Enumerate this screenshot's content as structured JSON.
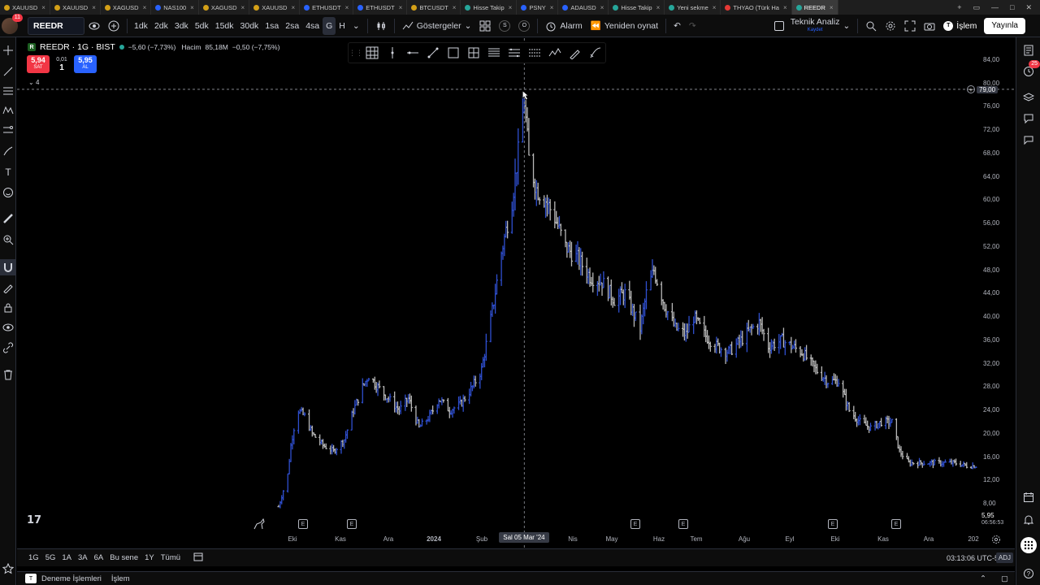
{
  "browser": {
    "tabs": [
      {
        "label": "XAUUSD",
        "fav": "y"
      },
      {
        "label": "XAUUSD",
        "fav": "y"
      },
      {
        "label": "XAGUSD",
        "fav": "y"
      },
      {
        "label": "NAS100",
        "fav": "b"
      },
      {
        "label": "XAGUSD",
        "fav": "y"
      },
      {
        "label": "XAUUSD",
        "fav": "y"
      },
      {
        "label": "ETHUSDT",
        "fav": "b"
      },
      {
        "label": "ETHUSDT",
        "fav": "b"
      },
      {
        "label": "BTCUSDT",
        "fav": "y"
      },
      {
        "label": "Hisse Takip",
        "fav": "g"
      },
      {
        "label": "PSNY",
        "fav": "b"
      },
      {
        "label": "ADAUSD",
        "fav": "b"
      },
      {
        "label": "Hisse Takip",
        "fav": "g"
      },
      {
        "label": "Yeni sekme",
        "fav": "g"
      },
      {
        "label": "THYAO (Türk Ha",
        "fav": "r"
      },
      {
        "label": "REEDR",
        "fav": "g",
        "active": true
      }
    ]
  },
  "toolbar": {
    "notifications": "11",
    "symbol": "REEDR",
    "intervals": [
      "1dk",
      "2dk",
      "3dk",
      "5dk",
      "15dk",
      "30dk",
      "1sa",
      "2sa",
      "4sa",
      "G",
      "H"
    ],
    "selected_interval": "G",
    "indicators_label": "Göstergeler",
    "alarm_label": "Alarm",
    "replay_label": "Yeniden oynat",
    "layout_name": "Teknik Analiz",
    "layout_status": "Kaydet",
    "trade_label": "İşlem",
    "publish_label": "Yayınla"
  },
  "legend": {
    "title": "REEDR · 1G · BIST",
    "change": "−5,60 (−7,73%)",
    "volume_label": "Hacim",
    "volume": "85,18M",
    "volume_change": "−0,50 (−7,75%)",
    "sell_price": "5,94",
    "sell_label": "SAT",
    "buy_price": "5,95",
    "buy_label": "AL",
    "spread": "0,01",
    "quantity": "1",
    "collapsed_count": "4"
  },
  "price_axis": {
    "ticks": [
      "84,00",
      "80,00",
      "76,00",
      "72,00",
      "68,00",
      "64,00",
      "60,00",
      "56,00",
      "52,00",
      "48,00",
      "44,00",
      "40,00",
      "36,00",
      "32,00",
      "28,00",
      "24,00",
      "20,00",
      "16,00",
      "12,00",
      "8,00"
    ],
    "crosshair_price": "79,00",
    "last_price": "5,95",
    "countdown": "06:56:53"
  },
  "time_axis": {
    "ticks": [
      "Eki",
      "Kas",
      "Ara",
      "2024",
      "Şub",
      "Nis",
      "May",
      "Haz",
      "Tem",
      "Ağu",
      "Eyl",
      "Eki",
      "Kas",
      "Ara",
      "202"
    ],
    "crosshair_time": "Sal 05 Mar '24",
    "event_badge": "E"
  },
  "bottom": {
    "ranges": [
      "1G",
      "5G",
      "1A",
      "3A",
      "6A",
      "Bu sene",
      "1Y",
      "Tümü"
    ],
    "clock": "03:13:06 UTC-5",
    "adj": "ADJ",
    "panel_left": "Deneme İşlemleri",
    "panel_right": "İşlem",
    "right_badge": "25"
  },
  "colors": {
    "up": "#2f4fcf",
    "down": "#b8b8b8",
    "crosshair": "#9598a1",
    "background": "#000000",
    "accent": "#2962ff",
    "sell": "#f23645"
  },
  "chart_data": {
    "type": "bar",
    "style": "ohlc-bars",
    "title": "REEDR · 1G · BIST",
    "ylim": [
      8,
      84
    ],
    "series": [
      {
        "values": [
          {
            "date": "2023-09-26",
            "price": 7.5
          },
          {
            "date": "2023-10-02",
            "price": 13
          },
          {
            "date": "2023-10-04",
            "price": 18
          },
          {
            "date": "2023-10-06",
            "price": 21
          },
          {
            "date": "2023-10-09",
            "price": 24
          },
          {
            "date": "2023-10-13",
            "price": 23
          },
          {
            "date": "2023-10-18",
            "price": 20
          },
          {
            "date": "2023-10-25",
            "price": 18
          },
          {
            "date": "2023-11-01",
            "price": 17
          },
          {
            "date": "2023-11-08",
            "price": 19
          },
          {
            "date": "2023-11-14",
            "price": 24
          },
          {
            "date": "2023-11-20",
            "price": 28
          },
          {
            "date": "2023-11-24",
            "price": 30
          },
          {
            "date": "2023-11-30",
            "price": 28
          },
          {
            "date": "2023-12-07",
            "price": 26
          },
          {
            "date": "2023-12-14",
            "price": 24
          },
          {
            "date": "2023-12-20",
            "price": 26
          },
          {
            "date": "2023-12-27",
            "price": 21
          },
          {
            "date": "2024-01-03",
            "price": 23
          },
          {
            "date": "2024-01-09",
            "price": 26
          },
          {
            "date": "2024-01-16",
            "price": 24
          },
          {
            "date": "2024-01-23",
            "price": 25
          },
          {
            "date": "2024-01-31",
            "price": 28
          },
          {
            "date": "2024-02-06",
            "price": 31
          },
          {
            "date": "2024-02-13",
            "price": 41
          },
          {
            "date": "2024-02-19",
            "price": 51
          },
          {
            "date": "2024-02-26",
            "price": 60
          },
          {
            "date": "2024-03-01",
            "price": 68
          },
          {
            "date": "2024-03-05",
            "price": 77
          },
          {
            "date": "2024-03-08",
            "price": 67
          },
          {
            "date": "2024-03-13",
            "price": 62
          },
          {
            "date": "2024-03-19",
            "price": 60
          },
          {
            "date": "2024-03-25",
            "price": 57
          },
          {
            "date": "2024-04-01",
            "price": 52
          },
          {
            "date": "2024-04-09",
            "price": 50
          },
          {
            "date": "2024-04-17",
            "price": 47
          },
          {
            "date": "2024-04-25",
            "price": 46
          },
          {
            "date": "2024-05-03",
            "price": 43
          },
          {
            "date": "2024-05-10",
            "price": 44
          },
          {
            "date": "2024-05-20",
            "price": 38
          },
          {
            "date": "2024-05-24",
            "price": 44
          },
          {
            "date": "2024-05-29",
            "price": 48
          },
          {
            "date": "2024-06-05",
            "price": 42
          },
          {
            "date": "2024-06-12",
            "price": 38
          },
          {
            "date": "2024-06-19",
            "price": 37
          },
          {
            "date": "2024-06-24",
            "price": 40
          },
          {
            "date": "2024-07-01",
            "price": 37
          },
          {
            "date": "2024-07-09",
            "price": 35
          },
          {
            "date": "2024-07-17",
            "price": 34
          },
          {
            "date": "2024-07-25",
            "price": 36
          },
          {
            "date": "2024-08-01",
            "price": 38
          },
          {
            "date": "2024-08-06",
            "price": 39
          },
          {
            "date": "2024-08-12",
            "price": 35
          },
          {
            "date": "2024-08-21",
            "price": 36
          },
          {
            "date": "2024-08-27",
            "price": 35
          },
          {
            "date": "2024-09-03",
            "price": 34
          },
          {
            "date": "2024-09-12",
            "price": 31
          },
          {
            "date": "2024-09-20",
            "price": 29
          },
          {
            "date": "2024-09-27",
            "price": 29
          },
          {
            "date": "2024-10-04",
            "price": 24
          },
          {
            "date": "2024-10-11",
            "price": 22
          },
          {
            "date": "2024-10-18",
            "price": 21
          },
          {
            "date": "2024-10-25",
            "price": 22
          },
          {
            "date": "2024-11-01",
            "price": 22
          },
          {
            "date": "2024-11-06",
            "price": 17
          },
          {
            "date": "2024-11-12",
            "price": 15
          },
          {
            "date": "2024-11-20",
            "price": 15
          },
          {
            "date": "2024-11-28",
            "price": 15
          },
          {
            "date": "2024-12-05",
            "price": 15
          },
          {
            "date": "2024-12-12",
            "price": 15
          },
          {
            "date": "2024-12-20",
            "price": 14.5
          },
          {
            "date": "2024-12-26",
            "price": 14.5
          }
        ]
      }
    ],
    "crosshair": {
      "date": "2024-03-05",
      "price": 79.0
    }
  }
}
